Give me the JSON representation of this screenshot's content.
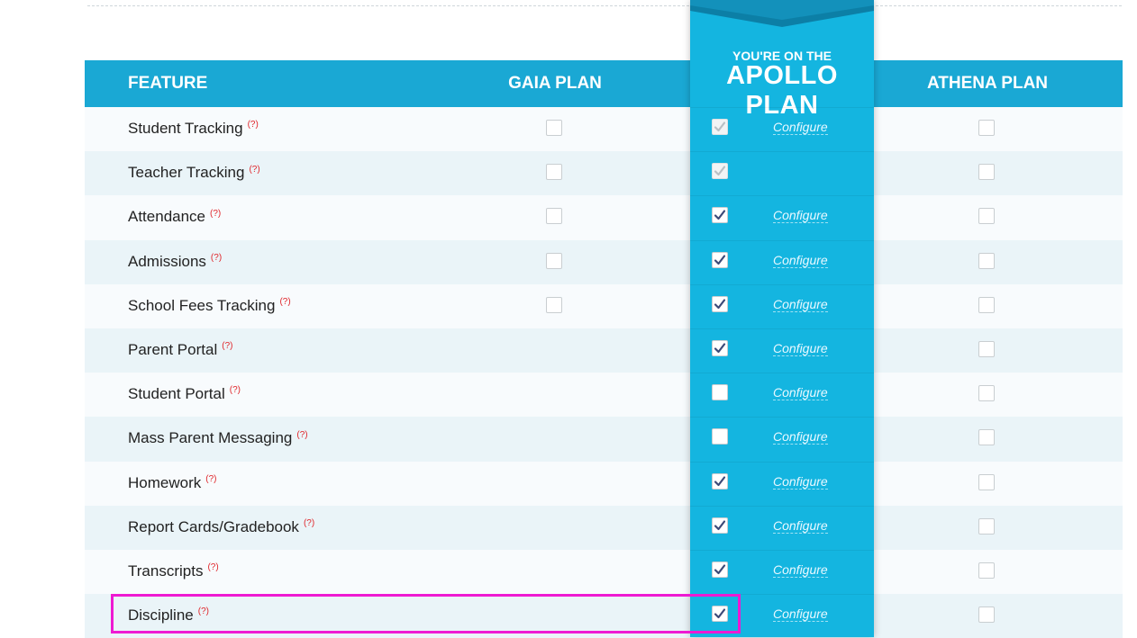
{
  "header": {
    "feature": "FEATURE",
    "gaia": "GAIA PLAN",
    "apollo_top": "YOU'RE ON THE",
    "apollo_name": "APOLLO PLAN",
    "athena": "ATHENA PLAN"
  },
  "help_marker": "(?)",
  "configure_label": "Configure",
  "features": [
    {
      "name": "Student Tracking",
      "gaia": true,
      "apollo": "checked-disabled",
      "configure": true
    },
    {
      "name": "Teacher Tracking",
      "gaia": true,
      "apollo": "checked-disabled",
      "configure": false
    },
    {
      "name": "Attendance",
      "gaia": true,
      "apollo": "checked",
      "configure": true
    },
    {
      "name": "Admissions",
      "gaia": true,
      "apollo": "checked",
      "configure": true
    },
    {
      "name": "School Fees Tracking",
      "gaia": true,
      "apollo": "checked",
      "configure": true
    },
    {
      "name": "Parent Portal",
      "gaia": false,
      "apollo": "checked",
      "configure": true
    },
    {
      "name": "Student Portal",
      "gaia": false,
      "apollo": "unchecked",
      "configure": true
    },
    {
      "name": "Mass Parent Messaging",
      "gaia": false,
      "apollo": "unchecked",
      "configure": true
    },
    {
      "name": "Homework",
      "gaia": false,
      "apollo": "checked",
      "configure": true
    },
    {
      "name": "Report Cards/Gradebook",
      "gaia": false,
      "apollo": "checked",
      "configure": true
    },
    {
      "name": "Transcripts",
      "gaia": false,
      "apollo": "checked",
      "configure": true
    },
    {
      "name": "Discipline",
      "gaia": false,
      "apollo": "checked",
      "configure": true
    }
  ],
  "colors": {
    "header_bg": "#1aa8d4",
    "apollo_bg": "#14b5e0",
    "help_marker": "#e0262b",
    "highlight": "#ee1ad2"
  }
}
